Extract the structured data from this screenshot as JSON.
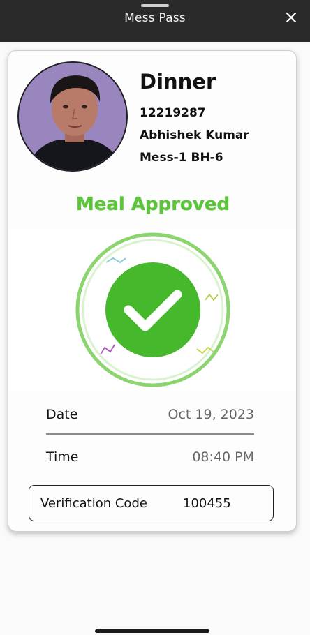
{
  "header": {
    "title": "Mess Pass",
    "close_icon": "close-icon"
  },
  "pass": {
    "meal": "Dinner",
    "id_number": "12219287",
    "name": "Abhishek Kumar",
    "mess": "Mess-1 BH-6",
    "status": "Meal Approved",
    "status_icon": "check-circle-icon",
    "date_label": "Date",
    "date_value": "Oct 19, 2023",
    "time_label": "Time",
    "time_value": "08:40 PM",
    "code_label": "Verification Code",
    "code_value": "100455"
  },
  "colors": {
    "topbar": "#2a2a2a",
    "approved_green": "#5bc43a",
    "badge_green": "#45b82c"
  }
}
